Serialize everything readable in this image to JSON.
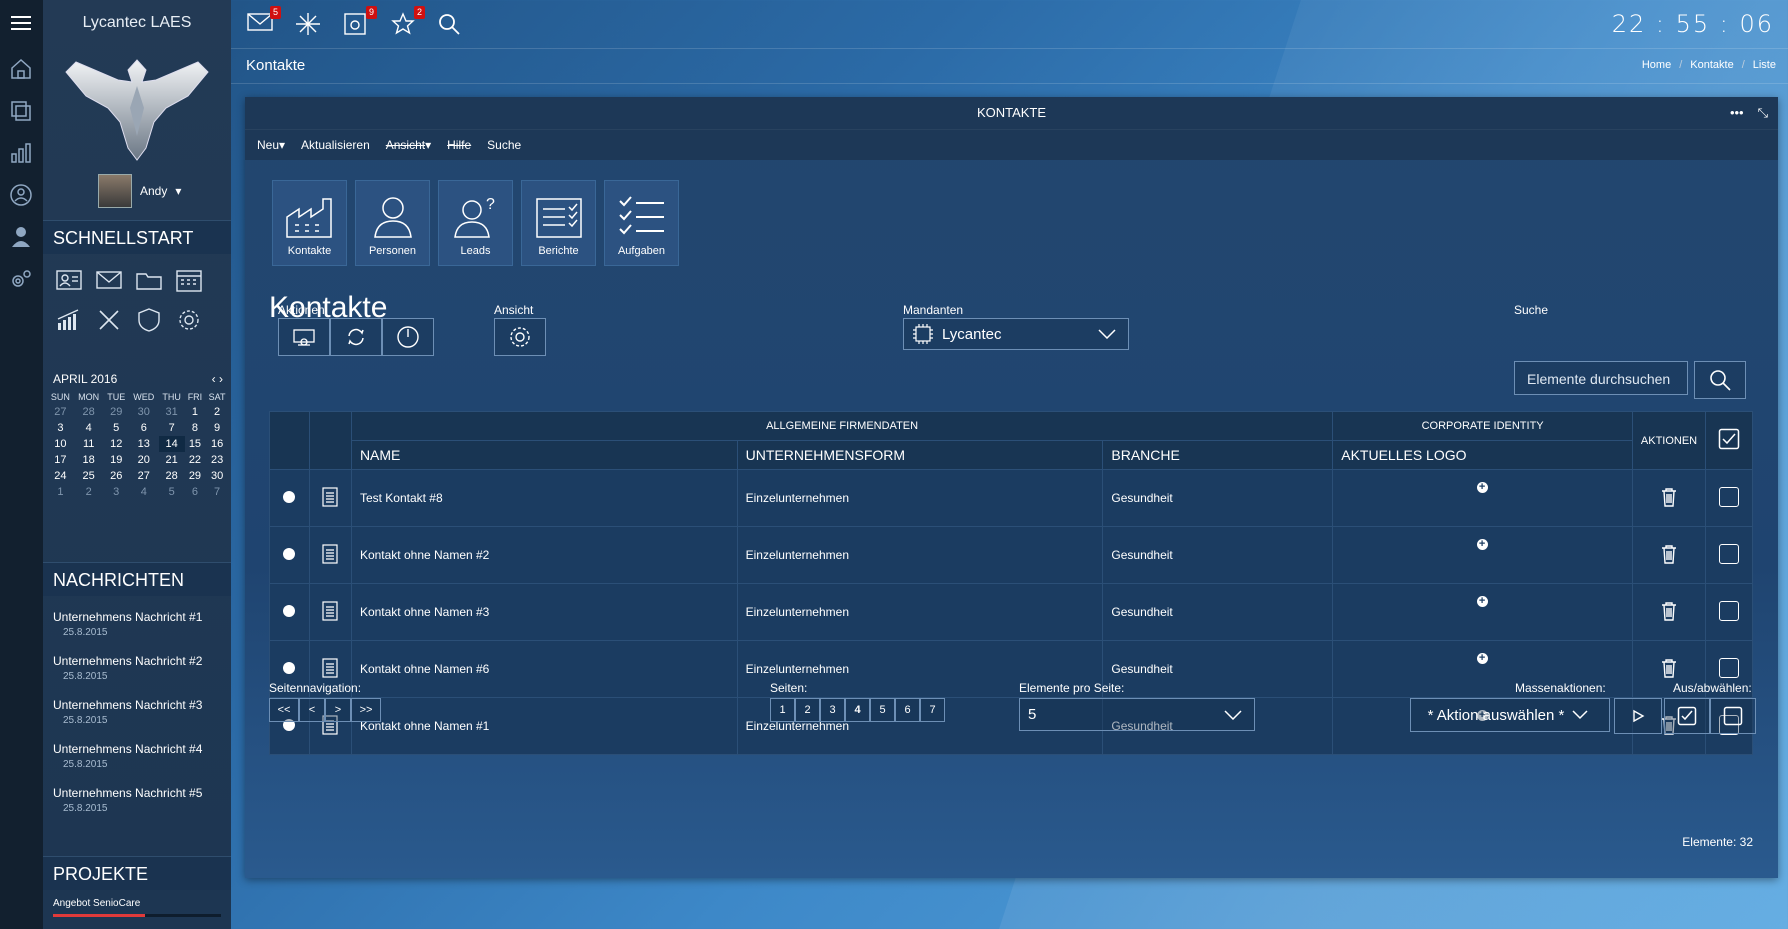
{
  "app": {
    "title": "Lycantec LAES",
    "clock": "22 : 55 : 06",
    "user": "Andy"
  },
  "topbar": {
    "badges": {
      "mail": "5",
      "news": "9",
      "favorites": "2"
    }
  },
  "page": {
    "title": "Kontakte",
    "breadcrumb": [
      "Home",
      "Kontakte",
      "Liste"
    ]
  },
  "sidebar": {
    "quickstart_title": "SCHNELLSTART",
    "calendar": {
      "month": "APRIL 2016",
      "weekdays": [
        "SUN",
        "MON",
        "TUE",
        "WED",
        "THU",
        "FRI",
        "SAT"
      ],
      "weeks": [
        [
          "27",
          "28",
          "29",
          "30",
          "31",
          "1",
          "2"
        ],
        [
          "3",
          "4",
          "5",
          "6",
          "7",
          "8",
          "9"
        ],
        [
          "10",
          "11",
          "12",
          "13",
          "14",
          "15",
          "16"
        ],
        [
          "17",
          "18",
          "19",
          "20",
          "21",
          "22",
          "23"
        ],
        [
          "24",
          "25",
          "26",
          "27",
          "28",
          "29",
          "30"
        ],
        [
          "1",
          "2",
          "3",
          "4",
          "5",
          "6",
          "7"
        ]
      ]
    },
    "messages_title": "NACHRICHTEN",
    "messages": [
      {
        "title": "Unternehmens Nachricht #1",
        "date": "25.8.2015"
      },
      {
        "title": "Unternehmens Nachricht #2",
        "date": "25.8.2015"
      },
      {
        "title": "Unternehmens Nachricht #3",
        "date": "25.8.2015"
      },
      {
        "title": "Unternehmens Nachricht #4",
        "date": "25.8.2015"
      },
      {
        "title": "Unternehmens Nachricht #5",
        "date": "25.8.2015"
      }
    ],
    "projects_title": "PROJEKTE",
    "projects": [
      {
        "name": "Angebot SenioCare",
        "progress": 0.55
      }
    ]
  },
  "panel": {
    "title": "KONTAKTE",
    "menu": {
      "new": "Neu",
      "refresh": "Aktualisieren",
      "view": "Ansicht",
      "help": "Hilfe",
      "search": "Suche"
    },
    "tiles": [
      "Kontakte",
      "Personen",
      "Leads",
      "Berichte",
      "Aufgaben"
    ],
    "heading": "Kontakte",
    "labels": {
      "actions": "Aktionen",
      "view": "Ansicht",
      "clients": "Mandanten",
      "search": "Suche"
    },
    "client_value": "Lycantec",
    "search_placeholder": "Elemente durchsuchen",
    "table": {
      "group_general": "ALLGEMEINE FIRMENDATEN",
      "group_ci": "CORPORATE IDENTITY",
      "col_name": "NAME",
      "col_form": "UNTERNEHMENSFORM",
      "col_branch": "BRANCHE",
      "col_logo": "AKTUELLES LOGO",
      "col_actions": "AKTIONEN",
      "rows": [
        {
          "name": "Test Kontakt #8",
          "form": "Einzelunternehmen",
          "branch": "Gesundheit"
        },
        {
          "name": "Kontakt ohne Namen #2",
          "form": "Einzelunternehmen",
          "branch": "Gesundheit"
        },
        {
          "name": "Kontakt ohne Namen #3",
          "form": "Einzelunternehmen",
          "branch": "Gesundheit"
        },
        {
          "name": "Kontakt ohne Namen #6",
          "form": "Einzelunternehmen",
          "branch": "Gesundheit"
        },
        {
          "name": "Kontakt ohne Namen #1",
          "form": "Einzelunternehmen",
          "branch": "Gesundheit"
        }
      ]
    },
    "footer": {
      "nav_label": "Seitennavigation:",
      "nav": [
        "<<",
        "<",
        ">",
        ">>"
      ],
      "pages_label": "Seiten:",
      "pages": [
        "1",
        "2",
        "3",
        "4",
        "5",
        "6",
        "7"
      ],
      "current_page": "4",
      "per_page_label": "Elemente pro Seite:",
      "per_page": "5",
      "mass_label": "Massenaktionen:",
      "mass_value": "* Aktion auswählen *",
      "toggle_label": "Aus/abwählen:",
      "elements": "Elemente: 32"
    }
  }
}
